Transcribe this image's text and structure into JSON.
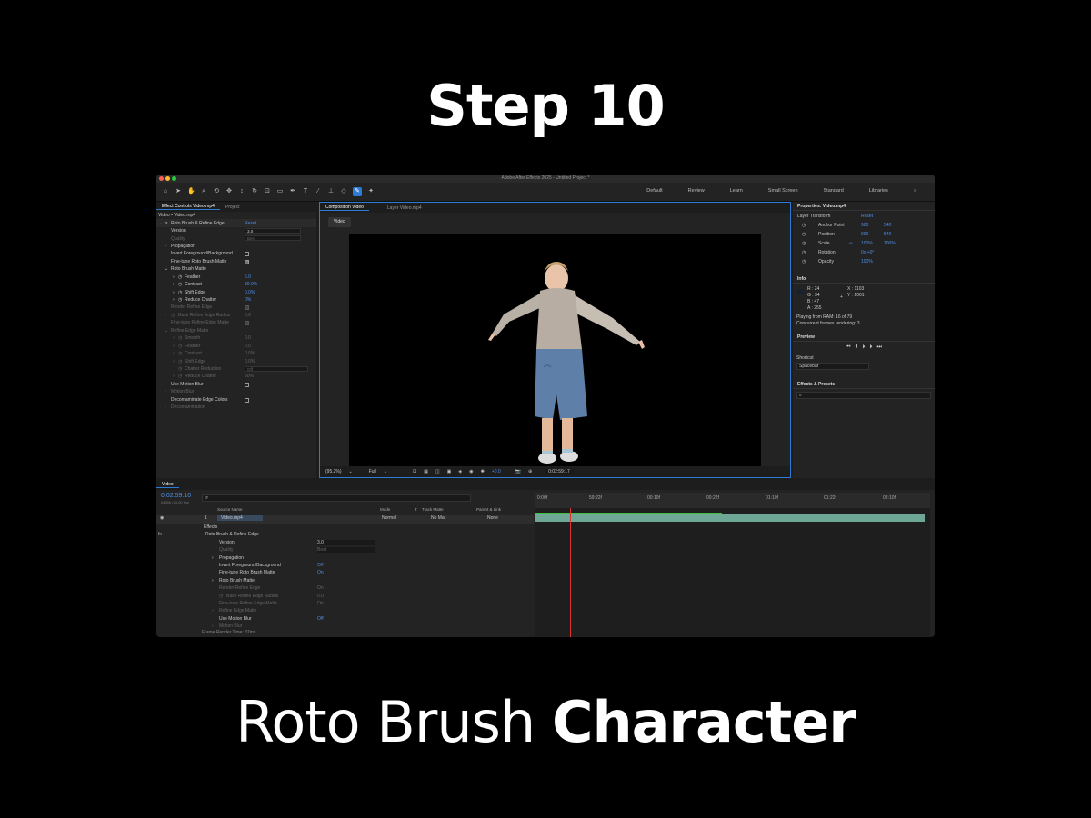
{
  "step_title": "Step 10",
  "footer": {
    "normal": "Roto Brush",
    "bold": "Character"
  },
  "window_title": "Adobe After Effects 2025 - Untitled Project *",
  "workspaces": [
    "Default",
    "Review",
    "Learn",
    "Small Screen",
    "Standard",
    "Libraries"
  ],
  "effect_controls": {
    "tab": "Effect Controls Video.mp4",
    "tab2": "Project",
    "layer": "Video • Video.mp4",
    "effect": "Roto Brush & Refine Edge",
    "reset": "Reset",
    "rows": [
      {
        "label": "Version",
        "value": "3.0"
      },
      {
        "label": "Quality",
        "value": "Best"
      },
      {
        "label": "Propagation",
        "value": ""
      },
      {
        "label": "Invert Foreground/Background",
        "value": ""
      },
      {
        "label": "Fine-tune Roto Brush Matte",
        "value": ""
      },
      {
        "label": "Roto Brush Matte",
        "value": ""
      },
      {
        "label": "Feather",
        "value": "5.0"
      },
      {
        "label": "Contrast",
        "value": "80.0%"
      },
      {
        "label": "Shift Edge",
        "value": "0.0%"
      },
      {
        "label": "Reduce Chatter",
        "value": "0%"
      },
      {
        "label": "Render Refine Edge",
        "value": ""
      },
      {
        "label": "Base Refine Edge Radius",
        "value": "0.0"
      },
      {
        "label": "Fine-tune Refine Edge Matte",
        "value": ""
      },
      {
        "label": "Refine Edge Matte",
        "value": ""
      },
      {
        "label": "Smooth",
        "value": "0.0"
      },
      {
        "label": "Feather",
        "value": "0.0"
      },
      {
        "label": "Contrast",
        "value": "0.0%"
      },
      {
        "label": "Shift Edge",
        "value": "0.0%"
      },
      {
        "label": "Chatter Reduction",
        "value": "Off"
      },
      {
        "label": "Reduce Chatter",
        "value": "50%"
      },
      {
        "label": "Use Motion Blur",
        "value": ""
      },
      {
        "label": "Motion Blur",
        "value": ""
      },
      {
        "label": "Decontaminate Edge Colors",
        "value": ""
      },
      {
        "label": "Decontamination",
        "value": ""
      }
    ]
  },
  "composition": {
    "tab": "Composition Video",
    "tab2": "Layer Video.mp4",
    "button": "Video",
    "zoom": "(95.2%)",
    "resolution": "Full",
    "exposure": "+0.0",
    "timecode": "0:02:59:17"
  },
  "properties": {
    "title": "Properties: Video.mp4",
    "group": "Layer Transform",
    "reset": "Reset",
    "rows": [
      {
        "label": "Anchor Point",
        "v1": "960",
        "v2": "540"
      },
      {
        "label": "Position",
        "v1": "960",
        "v2": "540"
      },
      {
        "label": "Scale",
        "v1": "100%",
        "v2": "100%"
      },
      {
        "label": "Rotation",
        "v1": "0x +0°",
        "v2": ""
      },
      {
        "label": "Opacity",
        "v1": "100%",
        "v2": ""
      }
    ],
    "info_title": "Info",
    "info": {
      "r": "R : 24",
      "g": "G : 34",
      "b": "B : 47",
      "a": "A : 255",
      "x": "X : 1103",
      "y": "Y : 1061"
    },
    "playing": "Playing from RAM: 16 of 79",
    "concurrent": "Concurrent frames rendering: 3",
    "preview_title": "Preview",
    "shortcut_label": "Shortcut",
    "shortcut_value": "Spacebar",
    "effects_title": "Effects & Presets"
  },
  "timeline": {
    "tab": "Video",
    "timecode": "0:02:59:10",
    "timecode_sub": "04306 (24.00 fps)",
    "columns": {
      "source": "Source Name",
      "mode": "Mode",
      "t": "T",
      "track": "Track Matte",
      "parent": "Parent & Link"
    },
    "layer": {
      "num": "1",
      "name": "Video.mp4",
      "mode": "Normal",
      "matte": "No Mat",
      "parent": "None"
    },
    "ruler": [
      "0:00f",
      "59:22f",
      "00:10f",
      "00:22f",
      "01:10f",
      "01:22f",
      "02:10f"
    ],
    "rows": [
      {
        "label": "Effects",
        "value": ""
      },
      {
        "label": "Roto Brush & Refine Edge",
        "value": ""
      },
      {
        "label": "Version",
        "value": "3.0"
      },
      {
        "label": "Quality",
        "value": "Best"
      },
      {
        "label": "Propagation",
        "value": ""
      },
      {
        "label": "Invert Foreground/Background",
        "value": "Off"
      },
      {
        "label": "Fine-tune Roto Brush Matte",
        "value": "On"
      },
      {
        "label": "Roto Brush Matte",
        "value": ""
      },
      {
        "label": "Render Refine Edge",
        "value": "On"
      },
      {
        "label": "Base Refine Edge Radius",
        "value": "0.0"
      },
      {
        "label": "Fine-tune Refine Edge Matte",
        "value": "On"
      },
      {
        "label": "Refine Edge Matte",
        "value": ""
      },
      {
        "label": "Use Motion Blur",
        "value": "Off"
      },
      {
        "label": "Motion Blur",
        "value": ""
      }
    ],
    "render_time": "Frame Render Time:  37ms"
  }
}
